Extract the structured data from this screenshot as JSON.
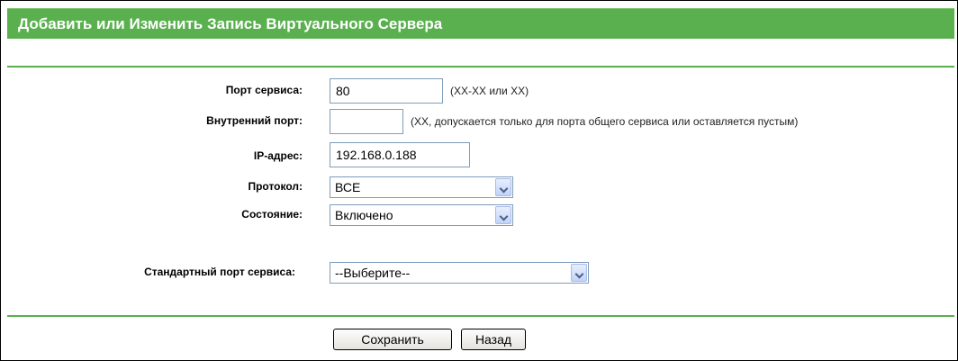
{
  "title": "Добавить или Изменить Запись Виртуального Сервера",
  "form": {
    "service_port": {
      "label": "Порт сервиса:",
      "value": "80",
      "hint": "(XX-XX или XX)"
    },
    "internal_port": {
      "label": "Внутренний порт:",
      "value": "",
      "hint": "(XX, допускается только для порта общего сервиса или оставляется пустым)"
    },
    "ip_address": {
      "label": "IP-адрес:",
      "value": "192.168.0.188"
    },
    "protocol": {
      "label": "Протокол:",
      "value": "ВСЕ"
    },
    "status": {
      "label": "Состояние:",
      "value": "Включено"
    },
    "common_port": {
      "label": "Стандартный порт сервиса:",
      "value": "--Выберите--"
    }
  },
  "buttons": {
    "save": "Сохранить",
    "back": "Назад"
  },
  "colors": {
    "title_bar": "#5ab04f",
    "rule": "#5ab04f",
    "input_border": "#7f9db9"
  }
}
